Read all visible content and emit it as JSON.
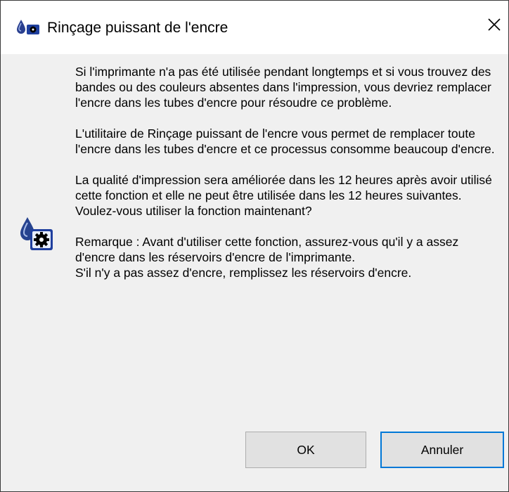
{
  "window": {
    "title": "Rinçage puissant de l'encre",
    "icon": "printer-ink-drop-icon",
    "close_icon": "close-icon"
  },
  "message": {
    "paragraph1": "Si l'imprimante n'a pas été utilisée pendant longtemps et si vous trouvez des bandes ou des couleurs absentes dans l'impression, vous devriez remplacer l'encre dans les tubes d'encre pour résoudre ce problème.",
    "paragraph2": "L'utilitaire de Rinçage puissant de l'encre vous permet de remplacer toute l'encre dans les tubes d'encre et ce processus consomme beaucoup d'encre.",
    "paragraph3": "La qualité d'impression sera améliorée dans les 12 heures après avoir utilisé cette fonction et elle ne peut être utilisée dans les 12 heures suivantes.",
    "question": "Voulez-vous utiliser la fonction maintenant?",
    "note_line1": "Remarque : Avant d'utiliser cette fonction, assurez-vous qu'il y a assez d'encre dans les réservoirs d'encre de l'imprimante.",
    "note_line2": "S'il n'y a pas assez d'encre, remplissez les réservoirs d'encre."
  },
  "message_icon": "ink-drop-gear-icon",
  "buttons": {
    "ok": "OK",
    "cancel": "Annuler"
  },
  "colors": {
    "client_background": "#f0f0f0",
    "button_face": "#e1e1e1",
    "focus_border": "#0078d7",
    "icon_blue": "#1f3f9e"
  }
}
